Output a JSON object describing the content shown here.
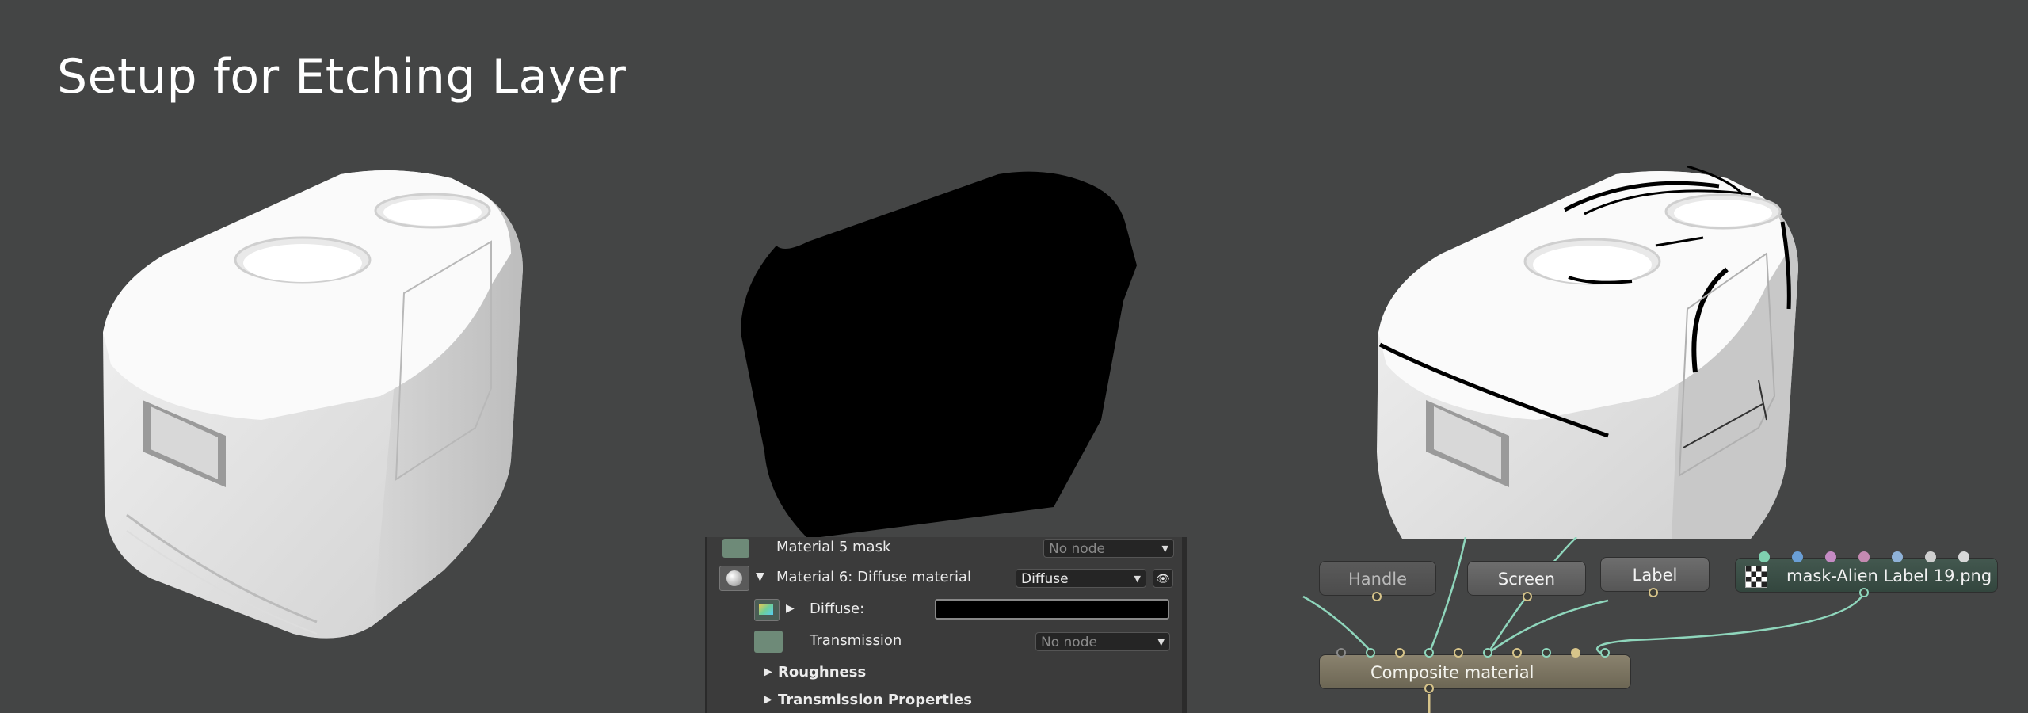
{
  "title": "Setup for Etching Layer",
  "panel": {
    "rows": [
      {
        "label": "Material 5 mask",
        "value": "No node"
      },
      {
        "label": "Material 6: Diffuse material",
        "value": "Diffuse"
      },
      {
        "label": "Diffuse:"
      },
      {
        "label": "Transmission",
        "value": "No node"
      },
      {
        "label": "Roughness"
      },
      {
        "label": "Transmission Properties"
      }
    ]
  },
  "nodes": {
    "handle": "Handle",
    "screen": "Screen",
    "label": "Label",
    "mask": "mask-Alien Label 19.png",
    "composite": "Composite material"
  },
  "colors": {
    "background": "#444545",
    "wire": "#8fd6bc",
    "connector": "#d7c48a"
  }
}
